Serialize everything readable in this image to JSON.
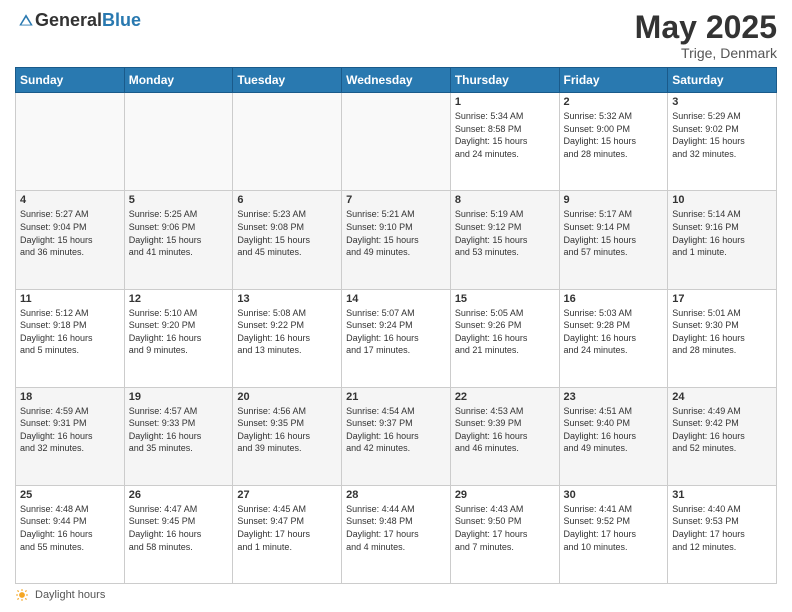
{
  "header": {
    "logo_general": "General",
    "logo_blue": "Blue",
    "month": "May 2025",
    "location": "Trige, Denmark"
  },
  "days_of_week": [
    "Sunday",
    "Monday",
    "Tuesday",
    "Wednesday",
    "Thursday",
    "Friday",
    "Saturday"
  ],
  "footer": {
    "daylight_label": "Daylight hours"
  },
  "weeks": [
    [
      {
        "day": "",
        "content": ""
      },
      {
        "day": "",
        "content": ""
      },
      {
        "day": "",
        "content": ""
      },
      {
        "day": "",
        "content": ""
      },
      {
        "day": "1",
        "content": "Sunrise: 5:34 AM\nSunset: 8:58 PM\nDaylight: 15 hours\nand 24 minutes."
      },
      {
        "day": "2",
        "content": "Sunrise: 5:32 AM\nSunset: 9:00 PM\nDaylight: 15 hours\nand 28 minutes."
      },
      {
        "day": "3",
        "content": "Sunrise: 5:29 AM\nSunset: 9:02 PM\nDaylight: 15 hours\nand 32 minutes."
      }
    ],
    [
      {
        "day": "4",
        "content": "Sunrise: 5:27 AM\nSunset: 9:04 PM\nDaylight: 15 hours\nand 36 minutes."
      },
      {
        "day": "5",
        "content": "Sunrise: 5:25 AM\nSunset: 9:06 PM\nDaylight: 15 hours\nand 41 minutes."
      },
      {
        "day": "6",
        "content": "Sunrise: 5:23 AM\nSunset: 9:08 PM\nDaylight: 15 hours\nand 45 minutes."
      },
      {
        "day": "7",
        "content": "Sunrise: 5:21 AM\nSunset: 9:10 PM\nDaylight: 15 hours\nand 49 minutes."
      },
      {
        "day": "8",
        "content": "Sunrise: 5:19 AM\nSunset: 9:12 PM\nDaylight: 15 hours\nand 53 minutes."
      },
      {
        "day": "9",
        "content": "Sunrise: 5:17 AM\nSunset: 9:14 PM\nDaylight: 15 hours\nand 57 minutes."
      },
      {
        "day": "10",
        "content": "Sunrise: 5:14 AM\nSunset: 9:16 PM\nDaylight: 16 hours\nand 1 minute."
      }
    ],
    [
      {
        "day": "11",
        "content": "Sunrise: 5:12 AM\nSunset: 9:18 PM\nDaylight: 16 hours\nand 5 minutes."
      },
      {
        "day": "12",
        "content": "Sunrise: 5:10 AM\nSunset: 9:20 PM\nDaylight: 16 hours\nand 9 minutes."
      },
      {
        "day": "13",
        "content": "Sunrise: 5:08 AM\nSunset: 9:22 PM\nDaylight: 16 hours\nand 13 minutes."
      },
      {
        "day": "14",
        "content": "Sunrise: 5:07 AM\nSunset: 9:24 PM\nDaylight: 16 hours\nand 17 minutes."
      },
      {
        "day": "15",
        "content": "Sunrise: 5:05 AM\nSunset: 9:26 PM\nDaylight: 16 hours\nand 21 minutes."
      },
      {
        "day": "16",
        "content": "Sunrise: 5:03 AM\nSunset: 9:28 PM\nDaylight: 16 hours\nand 24 minutes."
      },
      {
        "day": "17",
        "content": "Sunrise: 5:01 AM\nSunset: 9:30 PM\nDaylight: 16 hours\nand 28 minutes."
      }
    ],
    [
      {
        "day": "18",
        "content": "Sunrise: 4:59 AM\nSunset: 9:31 PM\nDaylight: 16 hours\nand 32 minutes."
      },
      {
        "day": "19",
        "content": "Sunrise: 4:57 AM\nSunset: 9:33 PM\nDaylight: 16 hours\nand 35 minutes."
      },
      {
        "day": "20",
        "content": "Sunrise: 4:56 AM\nSunset: 9:35 PM\nDaylight: 16 hours\nand 39 minutes."
      },
      {
        "day": "21",
        "content": "Sunrise: 4:54 AM\nSunset: 9:37 PM\nDaylight: 16 hours\nand 42 minutes."
      },
      {
        "day": "22",
        "content": "Sunrise: 4:53 AM\nSunset: 9:39 PM\nDaylight: 16 hours\nand 46 minutes."
      },
      {
        "day": "23",
        "content": "Sunrise: 4:51 AM\nSunset: 9:40 PM\nDaylight: 16 hours\nand 49 minutes."
      },
      {
        "day": "24",
        "content": "Sunrise: 4:49 AM\nSunset: 9:42 PM\nDaylight: 16 hours\nand 52 minutes."
      }
    ],
    [
      {
        "day": "25",
        "content": "Sunrise: 4:48 AM\nSunset: 9:44 PM\nDaylight: 16 hours\nand 55 minutes."
      },
      {
        "day": "26",
        "content": "Sunrise: 4:47 AM\nSunset: 9:45 PM\nDaylight: 16 hours\nand 58 minutes."
      },
      {
        "day": "27",
        "content": "Sunrise: 4:45 AM\nSunset: 9:47 PM\nDaylight: 17 hours\nand 1 minute."
      },
      {
        "day": "28",
        "content": "Sunrise: 4:44 AM\nSunset: 9:48 PM\nDaylight: 17 hours\nand 4 minutes."
      },
      {
        "day": "29",
        "content": "Sunrise: 4:43 AM\nSunset: 9:50 PM\nDaylight: 17 hours\nand 7 minutes."
      },
      {
        "day": "30",
        "content": "Sunrise: 4:41 AM\nSunset: 9:52 PM\nDaylight: 17 hours\nand 10 minutes."
      },
      {
        "day": "31",
        "content": "Sunrise: 4:40 AM\nSunset: 9:53 PM\nDaylight: 17 hours\nand 12 minutes."
      }
    ]
  ]
}
